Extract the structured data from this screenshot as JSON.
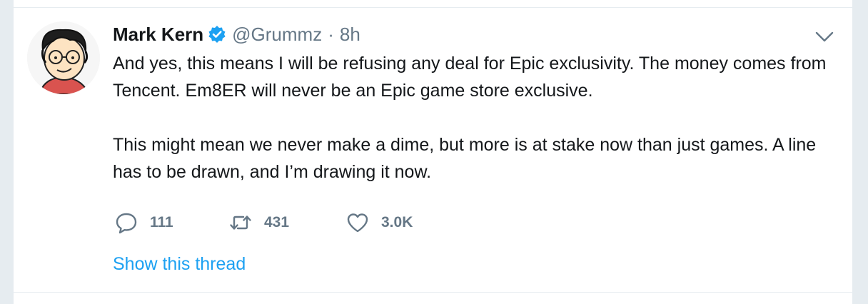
{
  "tweet": {
    "author_name": "Mark Kern",
    "handle": "@Grummz",
    "separator": "·",
    "time": "8h",
    "verified": true,
    "paragraphs": [
      "And yes, this means I will be refusing any deal for Epic exclusivity. The money comes from Tencent. Em8ER will never be an Epic game store exclusive.",
      "This might mean we never make a dime, but more is at stake now than just games. A line has to be drawn, and I’m drawing it now."
    ],
    "actions": {
      "reply_count": "111",
      "retweet_count": "431",
      "like_count": "3.0K"
    },
    "show_thread_label": "Show this thread"
  },
  "icons": {
    "verified": "verified-badge-icon",
    "menu": "chevron-down-icon",
    "reply": "reply-bubble-icon",
    "retweet": "retweet-arrows-icon",
    "like": "heart-outline-icon"
  },
  "colors": {
    "text_primary": "#14171a",
    "text_secondary": "#657786",
    "link_blue": "#1da1f2",
    "divider": "#e6ecf0"
  }
}
